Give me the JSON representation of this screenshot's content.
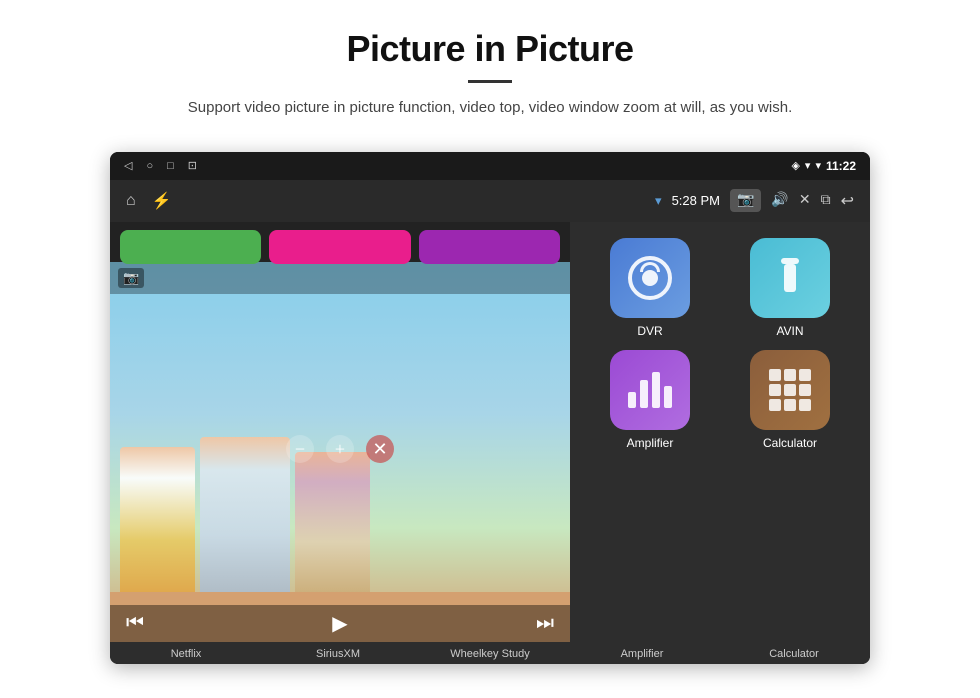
{
  "header": {
    "title": "Picture in Picture",
    "subtitle": "Support video picture in picture function, video top, video window zoom at will, as you wish."
  },
  "statusBar": {
    "time": "11:22",
    "icons": [
      "◁",
      "○",
      "□",
      "⊡"
    ]
  },
  "toolbar": {
    "time": "5:28 PM",
    "homeIcon": "⌂",
    "usbIcon": "⚡"
  },
  "videoPlayer": {
    "controls": {
      "minus": "−",
      "plus": "+",
      "close": "✕",
      "rewind": "⏮",
      "play": "▶",
      "forward": "⏭"
    }
  },
  "apps": {
    "topRow": [
      {
        "label": "Netflix",
        "color": "#4caf50"
      },
      {
        "label": "SiriusXM",
        "color": "#e91e8c"
      },
      {
        "label": "Wheelkey Study",
        "color": "#9c27b0"
      }
    ],
    "grid": [
      {
        "id": "dvr",
        "label": "DVR",
        "iconClass": "icon-dvr"
      },
      {
        "id": "avin",
        "label": "AVIN",
        "iconClass": "icon-avin"
      },
      {
        "id": "amplifier",
        "label": "Amplifier",
        "iconClass": "icon-amplifier"
      },
      {
        "id": "calculator",
        "label": "Calculator",
        "iconClass": "icon-calculator"
      }
    ]
  },
  "bottomLabels": [
    "Netflix",
    "SiriusXM",
    "Wheelkey Study",
    "Amplifier",
    "Calculator"
  ]
}
